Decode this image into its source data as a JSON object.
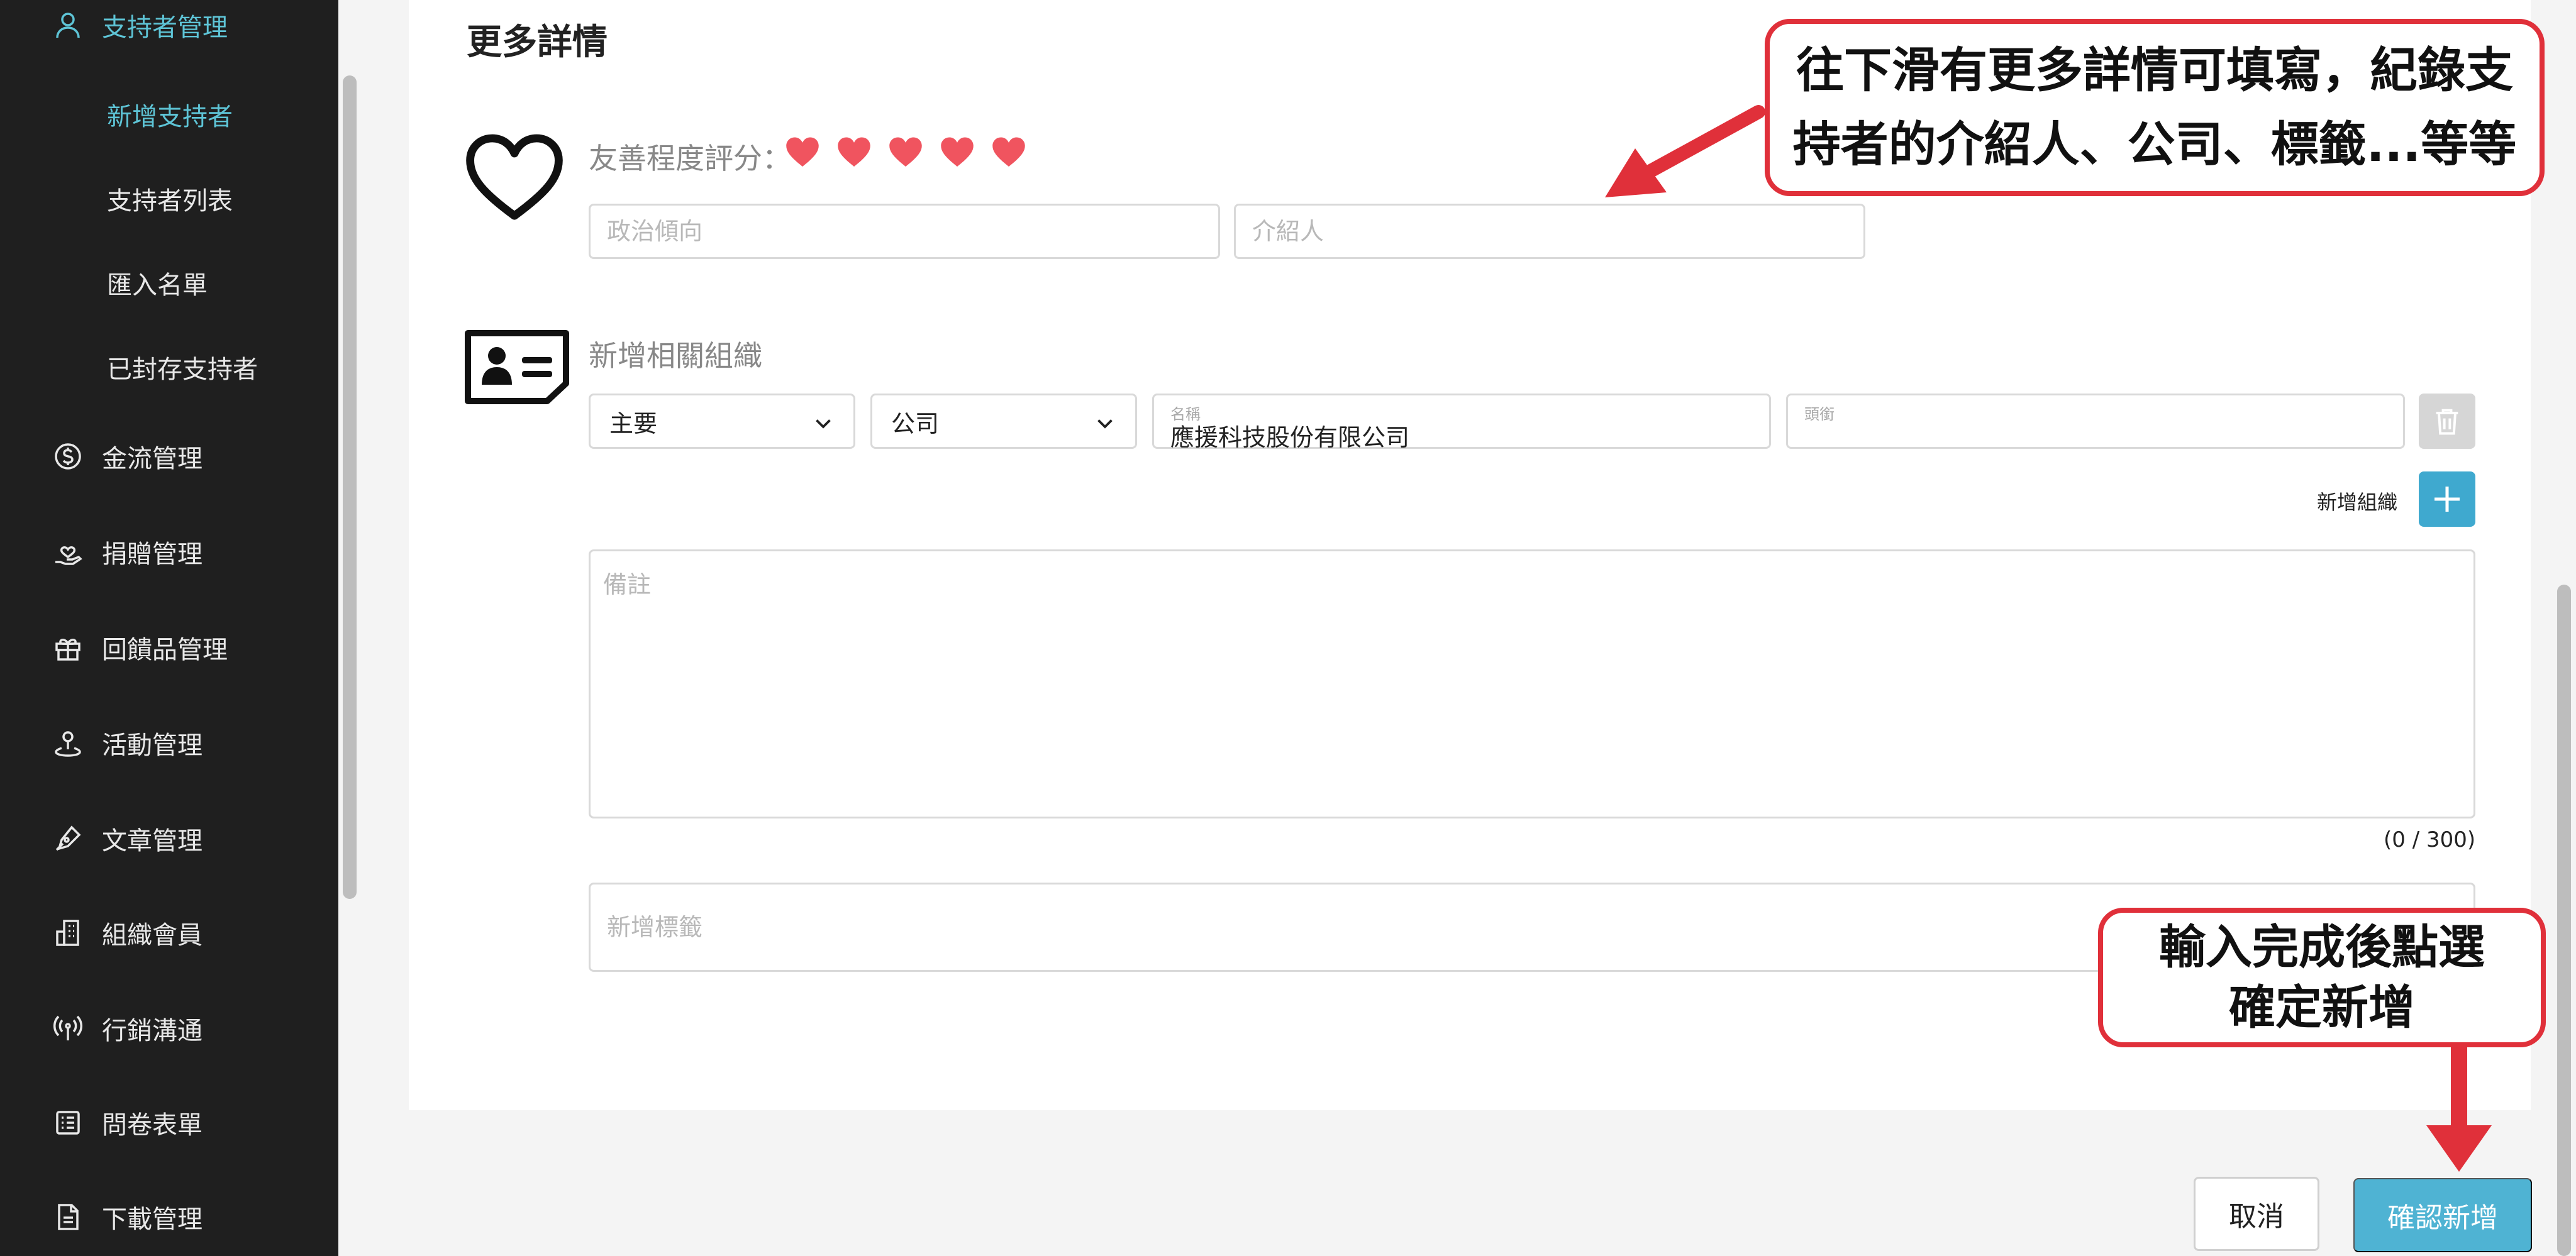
{
  "sidebar": {
    "items": [
      {
        "label": "支持者管理",
        "icon": "user-icon",
        "active": true
      },
      {
        "label": "金流管理",
        "icon": "dollar-circle-icon"
      },
      {
        "label": "捐贈管理",
        "icon": "hand-heart-icon"
      },
      {
        "label": "回饋品管理",
        "icon": "gift-icon"
      },
      {
        "label": "活動管理",
        "icon": "location-pin-icon"
      },
      {
        "label": "文章管理",
        "icon": "pen-icon"
      },
      {
        "label": "組織會員",
        "icon": "building-icon"
      },
      {
        "label": "行銷溝通",
        "icon": "broadcast-icon"
      },
      {
        "label": "問卷表單",
        "icon": "list-form-icon"
      },
      {
        "label": "下載管理",
        "icon": "document-icon"
      }
    ],
    "subitems": [
      {
        "label": "新增支持者",
        "active": true
      },
      {
        "label": "支持者列表"
      },
      {
        "label": "匯入名單"
      },
      {
        "label": "已封存支持者"
      }
    ]
  },
  "details": {
    "title": "更多詳情",
    "rating_label": "友善程度評分：",
    "rating": 5,
    "rating_max": 5,
    "political_placeholder": "政治傾向",
    "referrer_placeholder": "介紹人"
  },
  "organization": {
    "section_label": "新增相關組織",
    "type_select": "主要",
    "category_select": "公司",
    "name_label": "名稱",
    "name_value": "應援科技股份有限公司",
    "title_label": "頭銜",
    "add_label": "新增組織"
  },
  "notes": {
    "placeholder": "備註",
    "counter": "(0 / 300)"
  },
  "tags": {
    "placeholder": "新增標籤"
  },
  "actions": {
    "cancel": "取消",
    "confirm": "確認新增"
  },
  "annotations": {
    "callout_top_line1": "往下滑有更多詳情可填寫，紀錄支",
    "callout_top_line2": "持者的介紹人、公司、標籤...等等",
    "callout_bottom_line1": "輸入完成後點選",
    "callout_bottom_line2": "確定新增"
  },
  "colors": {
    "sidebar_bg": "#1f1f1f",
    "accent": "#5ec4d6",
    "heart": "#f0545f",
    "confirm": "#4fb3d3",
    "annotation_red": "#e0303a"
  }
}
